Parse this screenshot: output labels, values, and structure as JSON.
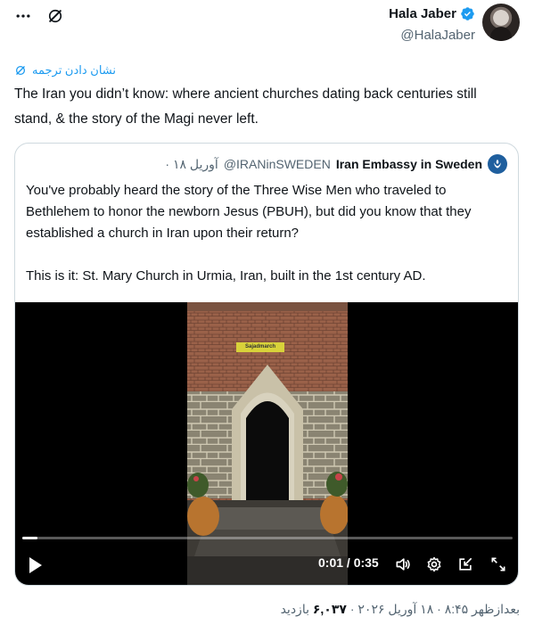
{
  "author": {
    "display_name": "Hala Jaber",
    "handle": "@HalaJaber"
  },
  "translate": {
    "label": "نشان دادن ترجمه"
  },
  "tweet": {
    "text": "The Iran you didn’t know: where ancient churches dating back centuries still stand, & the story of the Magi never left."
  },
  "quote": {
    "name": "Iran Embassy in Sweden",
    "handle": "@IRANinSWEDEN",
    "date": "· آوریل ۱۸",
    "text": "You've probably heard the story of the Three Wise Men who traveled to Bethlehem to honor the newborn Jesus (PBUH), but did you know that they established a church in Iran upon their return?\n\nThis is it: St. Mary Church in Urmia, Iran, built in the 1st century AD."
  },
  "video": {
    "time": "0:01 / 0:35",
    "progress": 0.03,
    "watermark": "Sajadmarch"
  },
  "meta": {
    "time": "بعدازظهر ۸:۴۵",
    "date": "۱۸ آوریل ۲۰۲۶",
    "views_label": "بازدید",
    "views": "۶,۰۳۷"
  },
  "icons": {
    "more": "more-icon",
    "grok": "grok-icon",
    "verified": "verified-badge-icon",
    "play": "play-icon",
    "volume": "volume-icon",
    "settings": "settings-gear-icon",
    "popout": "popout-icon",
    "fullscreen": "fullscreen-icon"
  },
  "colors": {
    "accent": "#1d9bf0",
    "text": "#0f1419",
    "secondary": "#536471"
  }
}
